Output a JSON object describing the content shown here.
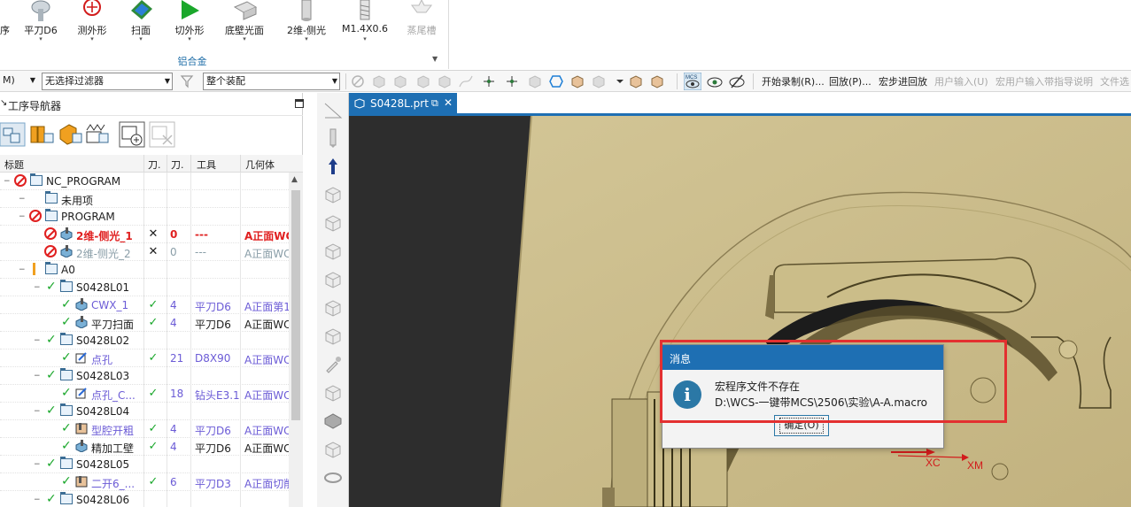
{
  "ribbon": {
    "tools": [
      {
        "label": "平刀D6",
        "icon": "flat-mill-tool-icon"
      },
      {
        "label": "测外形",
        "icon": "measure-profile-icon"
      },
      {
        "label": "扫面",
        "icon": "face-sweep-icon"
      },
      {
        "label": "切外形",
        "icon": "cut-profile-icon"
      },
      {
        "label": "底壁光面",
        "icon": "floor-wall-finish-icon"
      },
      {
        "label": "2维-侧光",
        "icon": "2d-side-finish-icon"
      },
      {
        "label": "M1.4X0.6",
        "icon": "thread-tool-icon"
      },
      {
        "label": "蒸尾槽",
        "icon": "dovetail-slot-icon",
        "disabled": true
      }
    ],
    "group_label": "铝合金",
    "left_stub": "序"
  },
  "toolbar": {
    "partial_menu": "M)",
    "filter_value": "无选择过滤器",
    "assembly_value": "整个装配",
    "macro_items": [
      {
        "label": "开始录制(R)...",
        "disabled": false
      },
      {
        "label": "回放(P)...",
        "disabled": false
      },
      {
        "label": "宏步进回放",
        "disabled": false
      },
      {
        "label": "用户输入(U)",
        "disabled": true
      },
      {
        "label": "宏用户输入带指导说明",
        "disabled": true
      },
      {
        "label": "文件选",
        "disabled": true
      }
    ]
  },
  "navigator": {
    "title": "工序导航器",
    "columns": [
      "标题",
      "刀.",
      "刀.",
      "工具",
      "几何体"
    ],
    "rows": [
      {
        "name": "NC_PROGRAM",
        "indent": 0,
        "status": "forbidden",
        "icon": "folder"
      },
      {
        "name": "未用项",
        "indent": 1,
        "status": "",
        "icon": "folder"
      },
      {
        "name": "PROGRAM",
        "indent": 1,
        "status": "forbidden",
        "icon": "folder"
      },
      {
        "name": "2维-侧光_1",
        "indent": 2,
        "status": "forbidden",
        "icon": "op",
        "c1": "✕",
        "c2": "0",
        "c3": "---",
        "c4": "A正面WC",
        "style": "red"
      },
      {
        "name": "2维-侧光_2",
        "indent": 2,
        "status": "forbidden",
        "icon": "op",
        "c1": "✕",
        "c2": "0",
        "c3": "---",
        "c4": "A正面WC",
        "style": "gray"
      },
      {
        "name": "A0",
        "indent": 1,
        "status": "warn",
        "icon": "folder"
      },
      {
        "name": "S0428L01",
        "indent": 2,
        "status": "ok",
        "icon": "folder"
      },
      {
        "name": "CWX_1",
        "indent": 3,
        "status": "ok",
        "icon": "op",
        "c1": "✓",
        "c2": "4",
        "c3": "平刀D6",
        "c4": "A正面第1",
        "style": "purple"
      },
      {
        "name": "平刀扫面",
        "indent": 3,
        "status": "ok",
        "icon": "op",
        "c1": "✓",
        "c2": "4",
        "c3": "平刀D6",
        "c4": "A正面WC",
        "style": ""
      },
      {
        "name": "S0428L02",
        "indent": 2,
        "status": "ok",
        "icon": "folder"
      },
      {
        "name": "点孔",
        "indent": 3,
        "status": "ok",
        "icon": "drill",
        "c1": "✓",
        "c2": "21",
        "c3": "D8X90",
        "c4": "A正面WC",
        "style": "purple"
      },
      {
        "name": "S0428L03",
        "indent": 2,
        "status": "ok",
        "icon": "folder"
      },
      {
        "name": "点孔_C...",
        "indent": 3,
        "status": "ok",
        "icon": "drill",
        "c1": "✓",
        "c2": "18",
        "c3": "钻头E3.1",
        "c4": "A正面WC",
        "style": "purple"
      },
      {
        "name": "S0428L04",
        "indent": 2,
        "status": "ok",
        "icon": "folder"
      },
      {
        "name": "型腔开粗",
        "indent": 3,
        "status": "ok",
        "icon": "cavity",
        "c1": "✓",
        "c2": "4",
        "c3": "平刀D6",
        "c4": "A正面WC",
        "style": "purple"
      },
      {
        "name": "精加工壁",
        "indent": 3,
        "status": "ok",
        "icon": "op",
        "c1": "✓",
        "c2": "4",
        "c3": "平刀D6",
        "c4": "A正面WC",
        "style": ""
      },
      {
        "name": "S0428L05",
        "indent": 2,
        "status": "ok",
        "icon": "folder"
      },
      {
        "name": "二开6_...",
        "indent": 3,
        "status": "ok",
        "icon": "cavity",
        "c1": "✓",
        "c2": "6",
        "c3": "平刀D3",
        "c4": "A正面切削",
        "style": "purple"
      },
      {
        "name": "S0428L06",
        "indent": 2,
        "status": "ok",
        "icon": "folder"
      }
    ]
  },
  "document_tab": {
    "label": "S0428L.prt"
  },
  "viewport": {
    "axis_labels": [
      "XC",
      "XM"
    ]
  },
  "dialog": {
    "title": "消息",
    "message": "宏程序文件不存在",
    "path": "D:\\WCS-一键带MCS\\2506\\实验\\A-A.macro",
    "ok_label": "确定(O)"
  },
  "colors": {
    "accent": "#1e6fb3",
    "error": "#e02020",
    "ok": "#1aa72b",
    "part": "#cdbf8d"
  }
}
